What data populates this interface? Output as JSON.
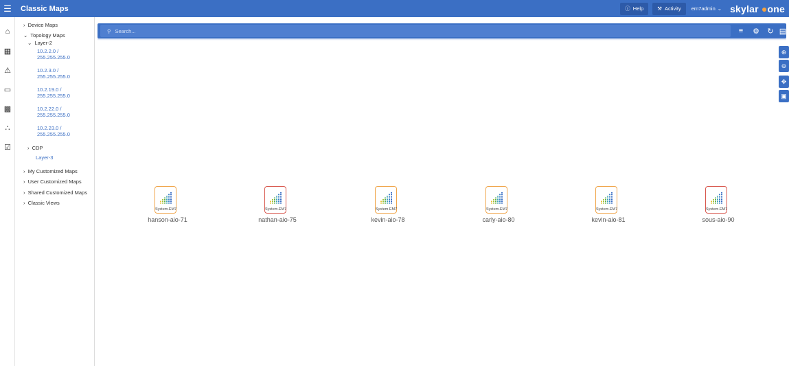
{
  "header": {
    "title": "Classic Maps",
    "help_label": "Help",
    "activity_label": "Activity",
    "user_label": "em7admin",
    "brand_main": "skylar",
    "brand_accent": "one",
    "colors": {
      "bar": "#3b6fc4",
      "accent": "#f4a340"
    }
  },
  "rail": {
    "icons": [
      "home-icon",
      "dashboard-icon",
      "alert-icon",
      "devices-icon",
      "business-services-icon",
      "topology-icon",
      "tasks-icon"
    ]
  },
  "tree": {
    "device_maps": "Device Maps",
    "topology_maps": "Topology Maps",
    "layer2": "Layer-2",
    "subnets": [
      {
        "line1": "10.2.2.0 /",
        "line2": "255.255.255.0"
      },
      {
        "line1": "10.2.3.0 /",
        "line2": "255.255.255.0"
      },
      {
        "line1": "10.2.19.0 /",
        "line2": "255.255.255.0"
      },
      {
        "line1": "10.2.22.0 /",
        "line2": "255.255.255.0"
      },
      {
        "line1": "10.2.23.0 /",
        "line2": "255.255.255.0"
      }
    ],
    "cdp": "CDP",
    "layer3": "Layer-3",
    "my_custom": "My Customized Maps",
    "user_custom": "User Customized Maps",
    "shared_custom": "Shared Customized Maps",
    "classic_views": "Classic Views"
  },
  "search": {
    "placeholder": "Search..."
  },
  "nodes": [
    {
      "name": "hanson-aio-71",
      "sys": "System.EM7",
      "status": "orange"
    },
    {
      "name": "nathan-aio-75",
      "sys": "System.EM7",
      "status": "red"
    },
    {
      "name": "kevin-aio-78",
      "sys": "System.EM7",
      "status": "orange"
    },
    {
      "name": "carly-aio-80",
      "sys": "System.EM7",
      "status": "orange"
    },
    {
      "name": "kevin-aio-81",
      "sys": "System.EM7",
      "status": "orange"
    },
    {
      "name": "sous-aio-90",
      "sys": "System.EM7",
      "status": "red"
    }
  ]
}
